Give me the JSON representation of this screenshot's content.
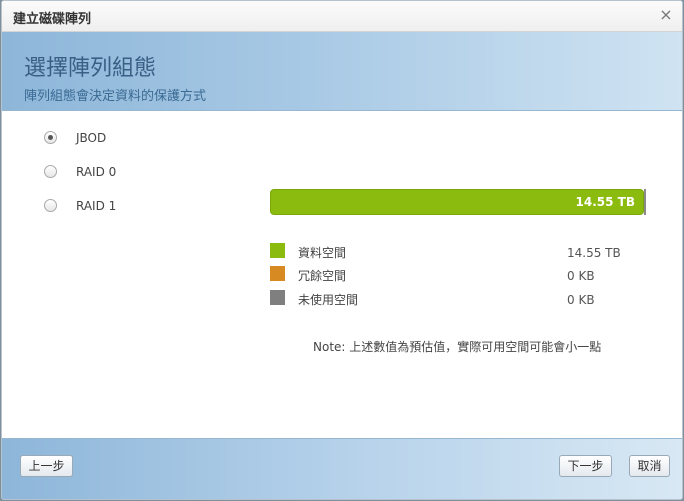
{
  "window": {
    "title": "建立磁碟陣列",
    "close_label": "×"
  },
  "header": {
    "title": "選擇陣列組態",
    "subtitle": "陣列組態會決定資料的保護方式"
  },
  "options": [
    {
      "label": "JBOD",
      "selected": true
    },
    {
      "label": "RAID 0",
      "selected": false
    },
    {
      "label": "RAID 1",
      "selected": false
    }
  ],
  "capacity_bar": {
    "label": "14.55 TB",
    "fill_fraction": 1.0,
    "color": "#8bbb0f"
  },
  "legend": [
    {
      "label": "資料空間",
      "value": "14.55 TB",
      "color": "#8bbb0f"
    },
    {
      "label": "冗餘空間",
      "value": "0 KB",
      "color": "#d78a22"
    },
    {
      "label": "未使用空間",
      "value": "0 KB",
      "color": "#7f7f7f"
    }
  ],
  "note": "Note: 上述數值為預估值，實際可用空間可能會小一點",
  "footer": {
    "prev_label": "上一步",
    "next_label": "下一步",
    "cancel_label": "取消"
  }
}
